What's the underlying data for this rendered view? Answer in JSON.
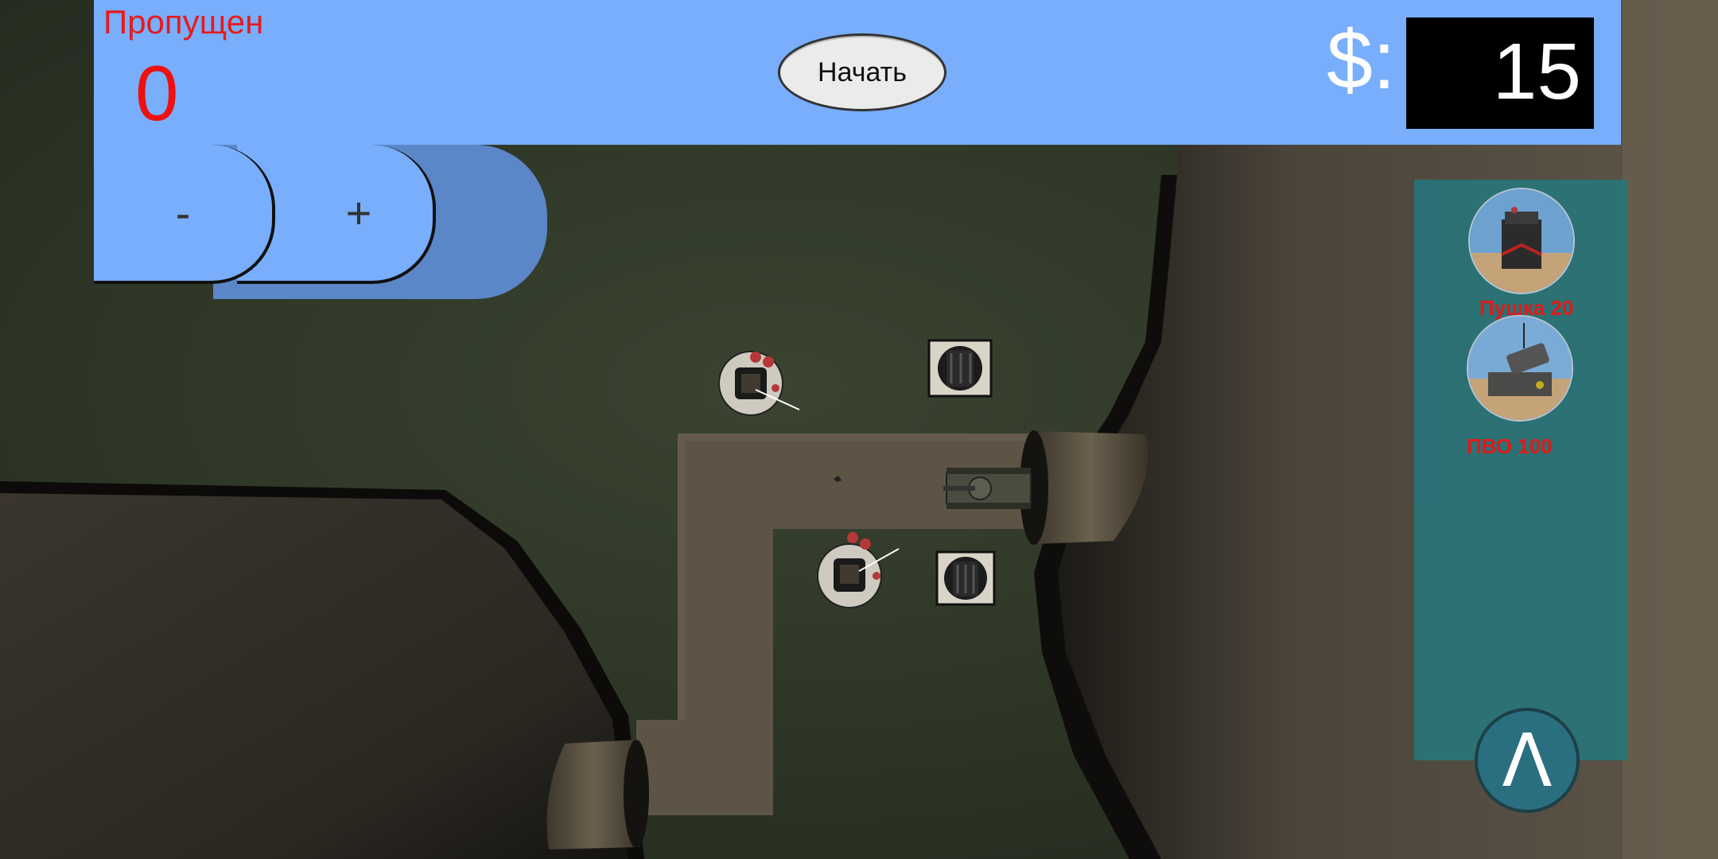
{
  "hud": {
    "missed_label": "Пропущен",
    "missed_value": "0",
    "start_label": "Начать",
    "money_label": "$:",
    "money_value": "15"
  },
  "zoom": {
    "minus_label": "-",
    "plus_label": "+"
  },
  "shop": {
    "items": [
      {
        "label": "Пушка 20",
        "icon": "cannon-turret-icon"
      },
      {
        "label": "ПВО 100",
        "icon": "air-defense-icon"
      }
    ],
    "toggle_label": "Λ"
  },
  "colors": {
    "hud_bar": "#78aefc",
    "missed_text": "#e81a1a",
    "shop_panel": "#2a7377",
    "shop_label": "#e81818"
  }
}
